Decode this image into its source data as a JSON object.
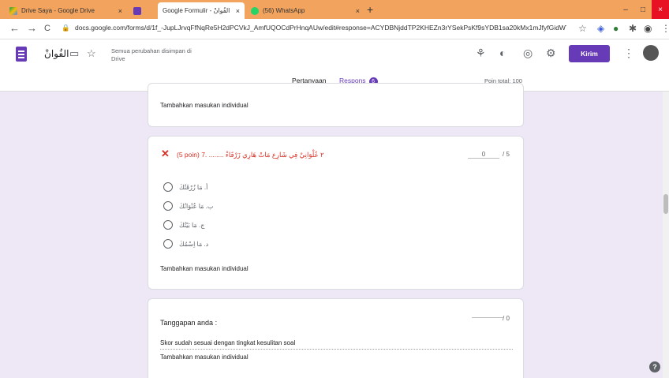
{
  "browser": {
    "tabs": [
      {
        "title": "Drive Saya - Google Drive",
        "close": "×"
      },
      {
        "title": "Google Formulir - الفُوانْ",
        "close": "×"
      },
      {
        "title": "(56) WhatsApp",
        "close": "×"
      }
    ],
    "new_tab": "+",
    "window_controls": [
      "–",
      "□",
      "×"
    ],
    "url": "docs.google.com/forms/d/1f_-JupLJrvqFfNqRe5H2dPCVkJ_AmfUQOCdPrHnqAUw/edit#response=ACYDBNjddTP2KHEZn3rYSekPsKf9sYDB1sa20kMx1mJfyfGidWTf...",
    "nav": {
      "back": "←",
      "forward": "→",
      "reload": "C"
    }
  },
  "header": {
    "form_title": "الفُوانْ",
    "saved_status": "Semua perubahan disimpan di Drive",
    "send_button": "Kirim",
    "more": "⋮"
  },
  "tabs": {
    "questions": "Pertanyaan",
    "responses": "Respons",
    "responses_count": "6",
    "total_points": "Poin total: 100"
  },
  "cards": {
    "card1": {
      "feedback": "Tambahkan masukan individual"
    },
    "card2": {
      "question": "(5 poin) ٢ عُلْوَانِيْ فِي شَارِع مَاتْ هَارِي زَرْقَاءْ ........ .7",
      "score_value": "0",
      "score_max": "/ 5",
      "options": [
        "أ. مَا زُرْقَتُكَ",
        "ب. مَا عُنْوَانُكَ",
        "ج. مَا بَيْتُكَ",
        "د. مَا اِسْمُكَ"
      ],
      "feedback": "Tambahkan masukan individual"
    },
    "card3": {
      "label": "Tanggapan anda :",
      "score_max": "/ 0",
      "comment": "Skor sudah sesuai dengan tingkat kesulitan soal",
      "feedback": "Tambahkan masukan individual"
    }
  },
  "help": "?"
}
